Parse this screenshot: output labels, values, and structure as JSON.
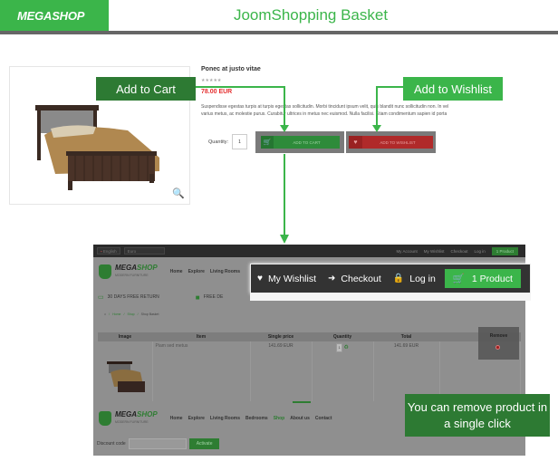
{
  "header": {
    "logo": "MEGASHOP",
    "title": "JoomShopping Basket"
  },
  "product": {
    "name": "Ponec at justo vitae",
    "rating": "★★★★★",
    "price": "78.00 EUR",
    "description": "Suspendisse egestas turpis at turpis egestas sollicitudin. Morbi tincidunt ipsum velit, quis blandit nunc sollicitudin non. In vel varius metus, ac molestie purus. Curabitur ultrices in metus nec euismod. Nulla facilisi. Etiam condimentum sapien id porta",
    "quantity_label": "Quantity:",
    "quantity_value": "1",
    "add_to_cart": "ADD TO CART",
    "add_to_wishlist": "ADD TO WISHLIST",
    "zoom_icon": "magnifier-plus-icon"
  },
  "callouts": {
    "cart": "Add to Cart",
    "wishlist": "Add to Wishlist",
    "remove": "You can remove product in a single click"
  },
  "colors": {
    "brand_green": "#3bb54a",
    "dark_green": "#2d7a33",
    "price_red": "#e53030",
    "wishlist_red": "#b02a2a"
  },
  "screenshot": {
    "topbar": {
      "language": "English",
      "currency": "Euro",
      "links": [
        "My Account",
        "My Wishlist",
        "Checkout",
        "Log in"
      ],
      "cart_button": "1 Product"
    },
    "logo_main": "MEGA",
    "logo_accent": "SHOP",
    "logo_sub": "MODERN FURNITURE",
    "nav": [
      "Home",
      "Explore",
      "Living Rooms",
      "Bedrooms",
      "Shop",
      "About us",
      "Contact"
    ],
    "features": [
      "30 DAYS FREE RETURN",
      "FREE DE"
    ],
    "breadcrumb": [
      "Home",
      "Shop",
      "Shop Basket"
    ],
    "table": {
      "headers": [
        "Image",
        "Item",
        "Single price",
        "Quantity",
        "Total",
        "Remove"
      ],
      "rows": [
        {
          "item": "Piam sed metus",
          "price": "141.69 EUR",
          "qty": "1",
          "total": "141.69 EUR"
        }
      ]
    },
    "discount_label": "Discount code",
    "activate": "Activate"
  },
  "nav_zoom": {
    "wishlist": "My Wishlist",
    "checkout": "Checkout",
    "login": "Log in",
    "cart": "1 Product"
  }
}
